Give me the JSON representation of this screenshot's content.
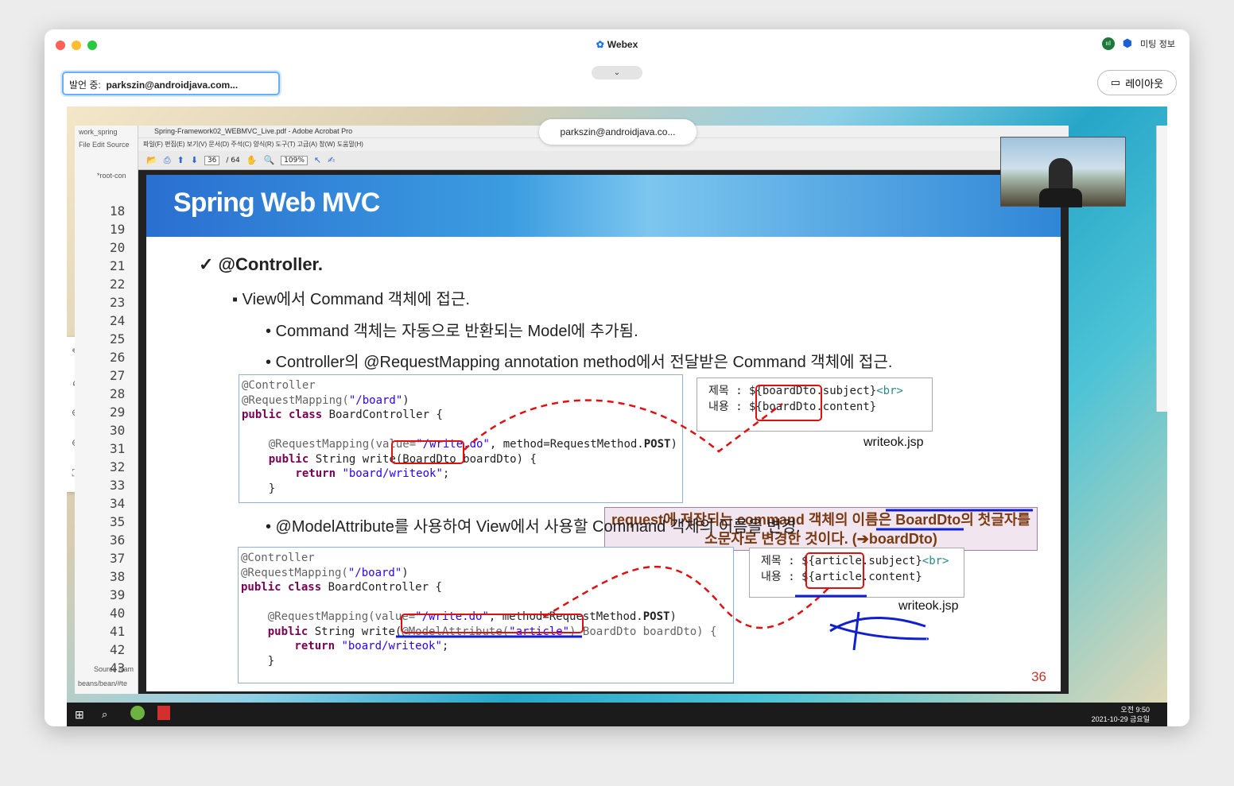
{
  "window": {
    "title": "Webex",
    "meeting_info": "미팅 정보",
    "signal": "ııl"
  },
  "speaker": {
    "label": "발언 중:",
    "name": "parkszin@androidjava.com..."
  },
  "layout_button": {
    "label": "레이아웃"
  },
  "share_tooltip": "parkszin@androidjava.co...",
  "ide": {
    "title": "work_spring",
    "menu": "File  Edit  Source",
    "tab": "*root-con",
    "line_numbers": [
      "18",
      "19",
      "20",
      "21",
      "22",
      "23",
      "24",
      "25",
      "26",
      "27",
      "28",
      "29",
      "30",
      "31",
      "32",
      "33",
      "34",
      "35",
      "36",
      "37",
      "38",
      "39",
      "40",
      "41",
      "42",
      "43"
    ],
    "bottom_tabs": "Source  Nam",
    "footer": "beans/bean/#te"
  },
  "acrobat": {
    "title": "Spring-Framework02_WEBMVC_Live.pdf - Adobe Acrobat Pro",
    "menu": "파일(F)  편집(E)  보기(V)  문서(D)  주석(C)  양식(R)  도구(T)  고급(A)  창(W)  도움말(H)",
    "page_current": "36",
    "page_total": "/ 64",
    "zoom": "109%"
  },
  "slide": {
    "banner": "Spring Web MVC",
    "heading": "✓ @Controller.",
    "bullet1": "▪  View에서 Command 객체에 접근.",
    "bullet2": "•  Command 객체는 자동으로 반환되는 Model에 추가됨.",
    "bullet3": "•  Controller의 @RequestMapping annotation method에서 전달받은 Command 객체에 접근.",
    "bullet4": "•  @ModelAttribute를 사용하여 View에서 사용할 Command 객체의 이름을 변경.",
    "code1": {
      "l1": "@Controller",
      "l2a": "@RequestMapping(",
      "l2b": "\"/board\"",
      "l2c": ")",
      "l3a": "public class",
      "l3b": " BoardController {",
      "l4a": "    @RequestMapping(value=",
      "l4b": "\"/write.do\"",
      "l4c": ", method=RequestMethod.",
      "l4d": "POST",
      "l4e": ")",
      "l5a": "    public",
      "l5b": " String write(BoardDto boardDto) {",
      "l6a": "        return",
      "l6b": " \"board/writeok\"",
      "l6c": ";",
      "l7": "    }"
    },
    "jsp1": {
      "l1a": "제목 : ${boardDto.subject}",
      "l1b": "<br>",
      "l2": "내용 : ${boardDto.content}"
    },
    "jsp1_caption": "writeok.jsp",
    "note": {
      "line1": "request에 저장되는 command 객체의 이름은 BoardDto의 첫글자를",
      "line2": "소문자로 변경한 것이다. (➔boardDto)"
    },
    "code2": {
      "l1": "@Controller",
      "l2a": "@RequestMapping(",
      "l2b": "\"/board\"",
      "l2c": ")",
      "l3a": "public class",
      "l3b": " BoardController {",
      "l4a": "    @RequestMapping(value=",
      "l4b": "\"/write.do\"",
      "l4c": ", method=RequestMethod.",
      "l4d": "POST",
      "l4e": ")",
      "l5a": "    public",
      "l5b": " String write(",
      "l5c": "@ModelAttribute(",
      "l5d": "\"article\"",
      "l5e": ") BoardDto boardDto) {",
      "l6a": "        return",
      "l6b": " \"board/writeok\"",
      "l6c": ";",
      "l7": "    }"
    },
    "jsp2": {
      "l1a": "제목 : ${article.subject}",
      "l1b": "<br>",
      "l2": "내용 : ${article.content}"
    },
    "jsp2_caption": "writeok.jsp",
    "page_number": "36"
  },
  "taskbar": {
    "time": "오전 9:50",
    "date": "2021-10-29 금요일"
  }
}
